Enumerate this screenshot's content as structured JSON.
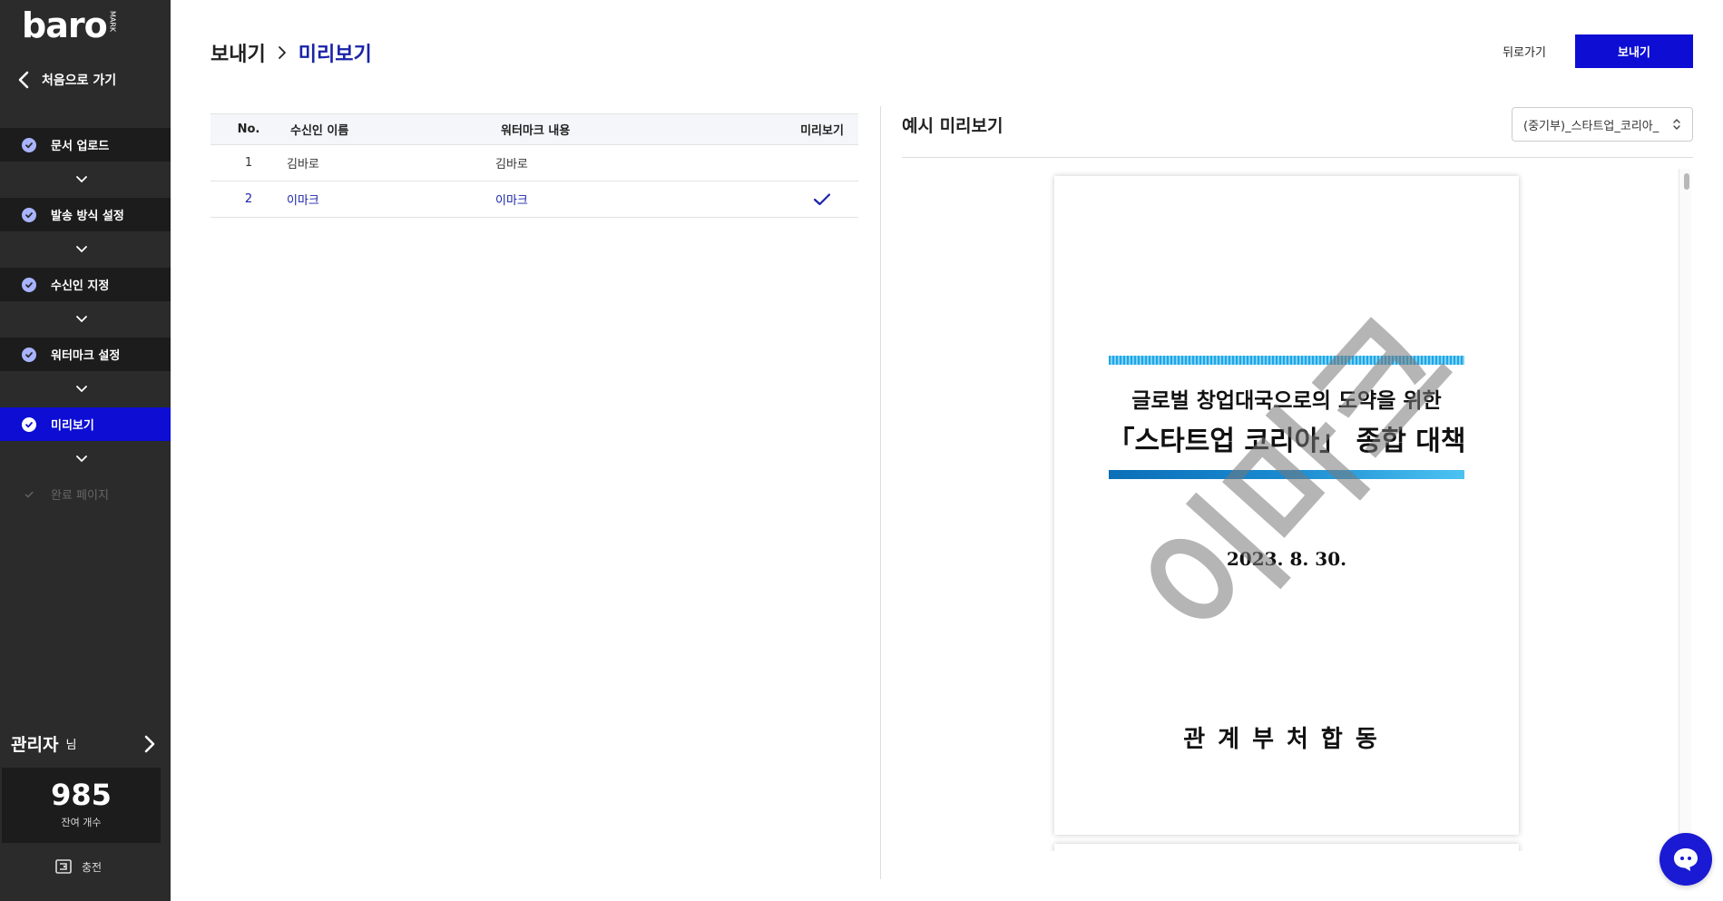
{
  "brand": {
    "logo_text": "baro",
    "logo_sub": "MARK"
  },
  "sidebar": {
    "back_label": "처음으로 가기",
    "steps": [
      {
        "label": "문서 업로드",
        "state": "done"
      },
      {
        "label": "발송 방식 설정",
        "state": "done"
      },
      {
        "label": "수신인 지정",
        "state": "done"
      },
      {
        "label": "워터마크 설정",
        "state": "done"
      },
      {
        "label": "미리보기",
        "state": "active"
      },
      {
        "label": "완료 페이지",
        "state": "disabled"
      }
    ],
    "admin_name": "관리자",
    "admin_suffix": "님",
    "credit_count": "985",
    "credit_label": "잔여 개수",
    "charge_label": "충전"
  },
  "header": {
    "breadcrumb_parent": "보내기",
    "breadcrumb_current": "미리보기",
    "back_button": "뒤로가기",
    "send_button": "보내기"
  },
  "table": {
    "headers": {
      "no": "No.",
      "name": "수신인 이름",
      "watermark": "워터마크 내용",
      "preview": "미리보기"
    },
    "rows": [
      {
        "no": "1",
        "name": "김바로",
        "watermark": "김바로",
        "selected": false
      },
      {
        "no": "2",
        "name": "이마크",
        "watermark": "이마크",
        "selected": true
      }
    ]
  },
  "preview": {
    "title": "예시 미리보기",
    "selected_doc": "(중기부)_스타트업_코리아_",
    "document": {
      "line1": "글로벌 창업대국으로의 도약을 위한",
      "line2": "「스타트업 코리아」 종합 대책",
      "date": "2023. 8. 30.",
      "org": "관계부처합동",
      "watermark_text": "이마크"
    }
  },
  "colors": {
    "accent": "#0d0dd4",
    "sidebar_bg": "#2b2b2b",
    "selected_text": "#1a23a8"
  },
  "icons": [
    "chevron-left-icon",
    "check-circle-icon",
    "chevron-down-icon",
    "chevron-right-icon",
    "wallet-icon",
    "checkmark-icon",
    "select-arrows-icon",
    "chat-icon"
  ]
}
